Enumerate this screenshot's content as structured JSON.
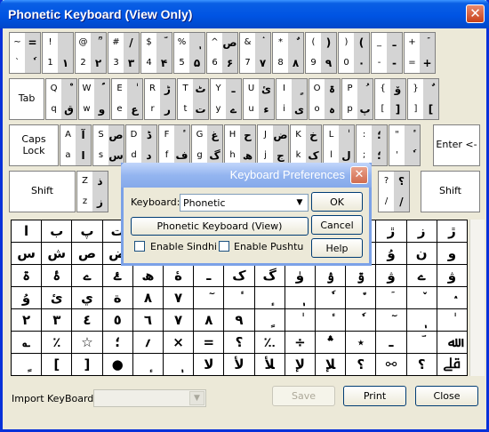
{
  "window": {
    "title": "Phonetic Keyboard (View Only)",
    "close_glyph": "✕"
  },
  "keyboard": {
    "rows": [
      [
        "~|=|`|ٗ",
        "!|‌|1|۱",
        "@|ؒ|2|۲",
        "#|/|3|۳",
        "$|ؔ|4|۴",
        "%|ٖ|5|۵",
        "^|ص|6|۶",
        "&|ۛ|7|۷",
        "*|ٌ|8|۸",
        "(|)|9|۹",
        ")|(|0|۰",
        "_|ـ|-|-",
        "+|ٙ|=|+"
      ],
      [
        "Q|ْ|q|ق",
        "W|ؐ|w|و",
        "E|ٰ|e|ع",
        "R|ڑ|r|ر",
        "T|ٹ|t|ت",
        "Y|ـ|y|ے",
        "U|ئ|u|ء",
        "I|ٍ|i|ی",
        "O|ۃ|o|ہ",
        "P|ُ|p|پ",
        "{|ۆ|[|]",
        "}|ٌ|]|["
      ],
      [
        "A|آ|a|ا",
        "S|ص|s|س",
        "D|ڈ|d|د",
        "F|ٔ|f|ف",
        "G|غ|g|گ",
        "H|ح|h|ھ",
        "J|ض|j|ج",
        "K|خ|k|ک",
        "L|ٰ|l|ل",
        ":|؛|;|؛",
        "\"|ٔ|'|ٗ"
      ],
      [
        "Z|ذ|z|ز",
        "?|؟|/|/"
      ]
    ],
    "special": {
      "tab": "Tab",
      "caps": "Caps\nLock",
      "enter": "Enter <-",
      "shift_left": "Shift",
      "shift_right": "Shift"
    }
  },
  "char_grid": {
    "rows": [
      [
        "ا",
        "ب",
        "پ",
        "ت",
        "",
        "",
        "",
        "",
        "",
        "",
        "",
        "",
        "ڙ",
        "ز",
        "ڙ"
      ],
      [
        "س",
        "ش",
        "ص",
        "ض",
        "",
        "",
        "",
        "",
        "",
        "",
        "",
        "",
        "ۇ",
        "ن",
        "و"
      ],
      [
        "ۃ",
        "ۂ",
        "ے",
        "ۓ",
        "ھ",
        "ۀ",
        "ـ",
        "ک",
        "گ",
        "ۈ",
        "ۉ",
        "ۊ",
        "ۋ",
        "ے",
        "ۋ"
      ],
      [
        "ۇ",
        "ئ",
        "ي",
        "ة",
        "٨",
        "٧",
        "ٓ",
        "ٔ",
        "ٕ",
        "ٖ",
        "ٗ",
        "٘",
        "ٙ",
        "ٚ",
        "ٛ"
      ],
      [
        "٢",
        "٣",
        "٤",
        "٥",
        "٦",
        "٧",
        "٨",
        "٩",
        "ٍ",
        "ٰ",
        "ٔ",
        "ٗ",
        "ٓ",
        "ٖ",
        "ٰ"
      ],
      [
        "؎",
        "٪",
        "☆",
        "؛",
        "؍",
        "×",
        "=",
        "؟",
        "؉",
        "÷",
        "؞",
        "٭",
        "ـ",
        "ؔ",
        "ﷲ"
      ],
      [
        "ٍ",
        "[",
        "]",
        "●",
        "ٕ",
        "ٖ",
        "ﻻ",
        "ﻷ",
        "ﻸ",
        "ﻹ",
        "ﻺ",
        "؟",
        "⚯",
        "؟",
        "ﷱ"
      ]
    ]
  },
  "preferences_dialog": {
    "title": "Keyboard Preferences",
    "close_glyph": "✕",
    "keyboard_label": "Keyboard:",
    "keyboard_value": "Phonetic",
    "ok": "OK",
    "view_button": "Phonetic Keyboard (View)",
    "cancel": "Cancel",
    "enable_sindhi": "Enable Sindhi",
    "enable_pushtu": "Enable Pushtu",
    "help": "Help"
  },
  "footer": {
    "import_label": "Import KeyBoard:",
    "save": "Save",
    "print": "Print",
    "close": "Close"
  }
}
